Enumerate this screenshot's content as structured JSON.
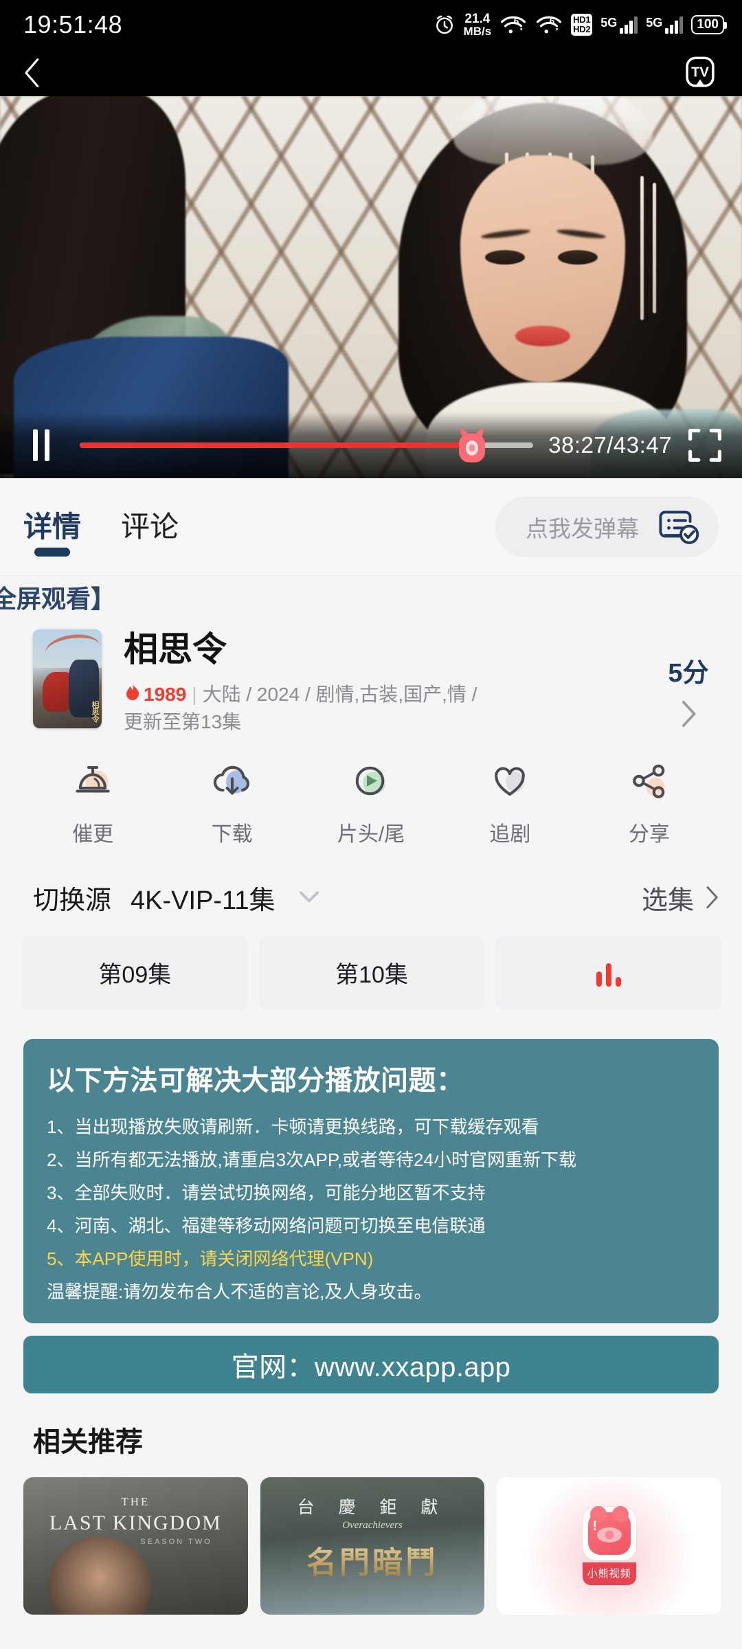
{
  "status_bar": {
    "clock": "19:51:48",
    "alarm_icon": "alarm-clock-icon",
    "net_speed_value": "21.4",
    "net_speed_unit": "MB/s",
    "wifi_icon_1": "wifi-6-icon",
    "wifi_icon_2": "wifi-6-icon",
    "hd_badge_line1": "HD1",
    "hd_badge_line2": "HD2",
    "sim1_network": "5G",
    "sim2_network": "5G",
    "battery_percent": "100"
  },
  "player": {
    "back_icon": "back-chevron-icon",
    "cast_label": "TV",
    "pause_icon": "pause-icon",
    "time_display": "38:27/43:47",
    "current_time": "38:27",
    "total_time": "43:47",
    "progress_percent": 86.5,
    "fullscreen_icon": "fullscreen-icon",
    "thumb_icon": "cat-thumb-icon",
    "progress_color": "#f0322e"
  },
  "tabs": {
    "items": [
      {
        "label": "详情",
        "active": true
      },
      {
        "label": "评论",
        "active": false
      }
    ],
    "danmaku": {
      "label": "点我发弹幕",
      "icon": "danmaku-list-check-icon"
    }
  },
  "marquee": {
    "text": "全屏观看】"
  },
  "movie": {
    "poster_title": "相思令",
    "title": "相思令",
    "hot_icon": "flame-icon",
    "hot_count": "1989",
    "separator": "|",
    "meta_line": "大陆 / 2024 / 剧情,古装,国产,情 /",
    "meta_line2": "更新至第13集",
    "score": "5分",
    "chevron_icon": "chevron-right-icon"
  },
  "actions": [
    {
      "label": "催更",
      "icon": "service-bell-icon"
    },
    {
      "label": "下载",
      "icon": "cloud-download-icon"
    },
    {
      "label": "片头/尾",
      "icon": "play-circle-icon"
    },
    {
      "label": "追剧",
      "icon": "heart-icon"
    },
    {
      "label": "分享",
      "icon": "share-icon"
    }
  ],
  "source_row": {
    "label": "切换源",
    "value": "4K-VIP-11集",
    "caret_icon": "chevron-down-icon",
    "select_label": "选集",
    "select_chevron": "chevron-right-icon"
  },
  "episodes": [
    {
      "label": "第09集",
      "playing": false
    },
    {
      "label": "第10集",
      "playing": false
    },
    {
      "label": "",
      "playing": true,
      "icon": "equalizer-playing-icon"
    }
  ],
  "notice": {
    "heading": "以下方法可解决大部分播放问题：",
    "items": [
      {
        "text": "1、当出现播放失败请刷新．卡顿请更换线路，可下载缓存观看",
        "highlight": false
      },
      {
        "text": "2、当所有都无法播放,请重启3次APP,或者等待24小时官网重新下载",
        "highlight": false
      },
      {
        "text": "3、全部失败时．请尝试切换网络，可能分地区暂不支持",
        "highlight": false
      },
      {
        "text": "4、河南、湖北、福建等移动网络问题可切换至电信联通",
        "highlight": false
      },
      {
        "text": "5、本APP使用时，请关闭网络代理(VPN)",
        "highlight": true
      }
    ],
    "tip": "温馨提醒:请勿发布合人不适的言论,及人身攻击。",
    "bg_color": "#4a8591",
    "highlight_color": "#ffd24a"
  },
  "banner": {
    "text": "官网：www.xxapp.app",
    "bg_color": "#3f8290"
  },
  "recommend": {
    "heading": "相关推荐",
    "cards": [
      {
        "line1": "THE",
        "line2": "LAST KINGDOM",
        "line3": "SEASON TWO"
      },
      {
        "line1": "台 慶 鉅 獻",
        "line2": "Overachievers",
        "line3": "名門暗鬥"
      },
      {
        "app_name": "小熊视频",
        "badge": "!"
      }
    ]
  }
}
